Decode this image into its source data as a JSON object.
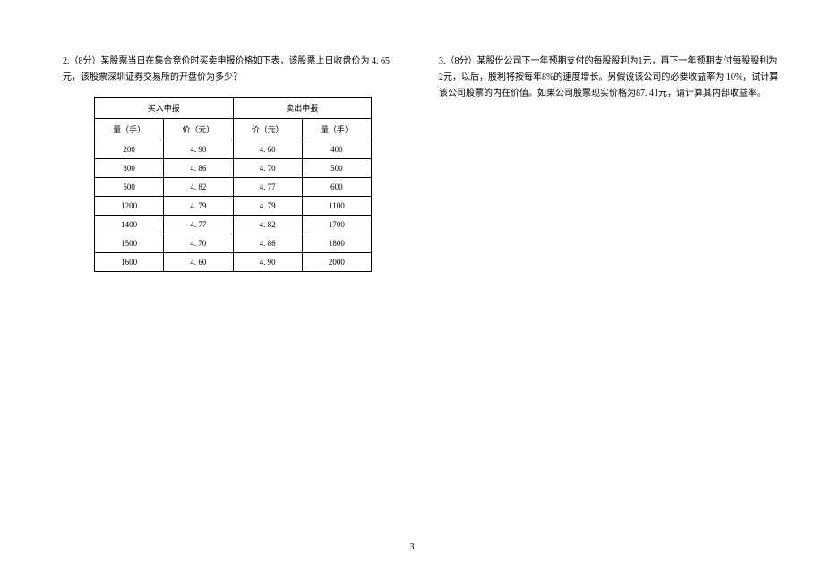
{
  "question2": {
    "text": "2.（8分）某股票当日在集合竞价时买卖申报价格如下表，该股票上日收盘价为 4. 65元，该股票深圳证券交易所的开盘价为多少？",
    "table": {
      "header_buy": "买入申报",
      "header_sell": "卖出申报",
      "col_qty": "量（手）",
      "col_price": "价（元）",
      "rows": [
        {
          "buy_qty": "200",
          "buy_price": "4. 90",
          "sell_price": "4. 60",
          "sell_qty": "400"
        },
        {
          "buy_qty": "300",
          "buy_price": "4. 86",
          "sell_price": "4. 70",
          "sell_qty": "500"
        },
        {
          "buy_qty": "500",
          "buy_price": "4. 82",
          "sell_price": "4. 77",
          "sell_qty": "600"
        },
        {
          "buy_qty": "1200",
          "buy_price": "4. 79",
          "sell_price": "4. 79",
          "sell_qty": "1100"
        },
        {
          "buy_qty": "1400",
          "buy_price": "4. 77",
          "sell_price": "4. 82",
          "sell_qty": "1700"
        },
        {
          "buy_qty": "1500",
          "buy_price": "4. 70",
          "sell_price": "4. 86",
          "sell_qty": "1800"
        },
        {
          "buy_qty": "1600",
          "buy_price": "4. 60",
          "sell_price": "4. 90",
          "sell_qty": "2000"
        }
      ]
    }
  },
  "question3": {
    "text": "3.（8分）某股份公司下一年预期支付的每股股利为1元，再下一年预期支付每股股利为2元，以后，股利将按每年8%的速度增长。另假设该公司的必要收益率为 10%，试计算该公司股票的内在价值。如果公司股票现实价格为87. 41元，请计算其内部收益率。"
  },
  "page_number": "3"
}
